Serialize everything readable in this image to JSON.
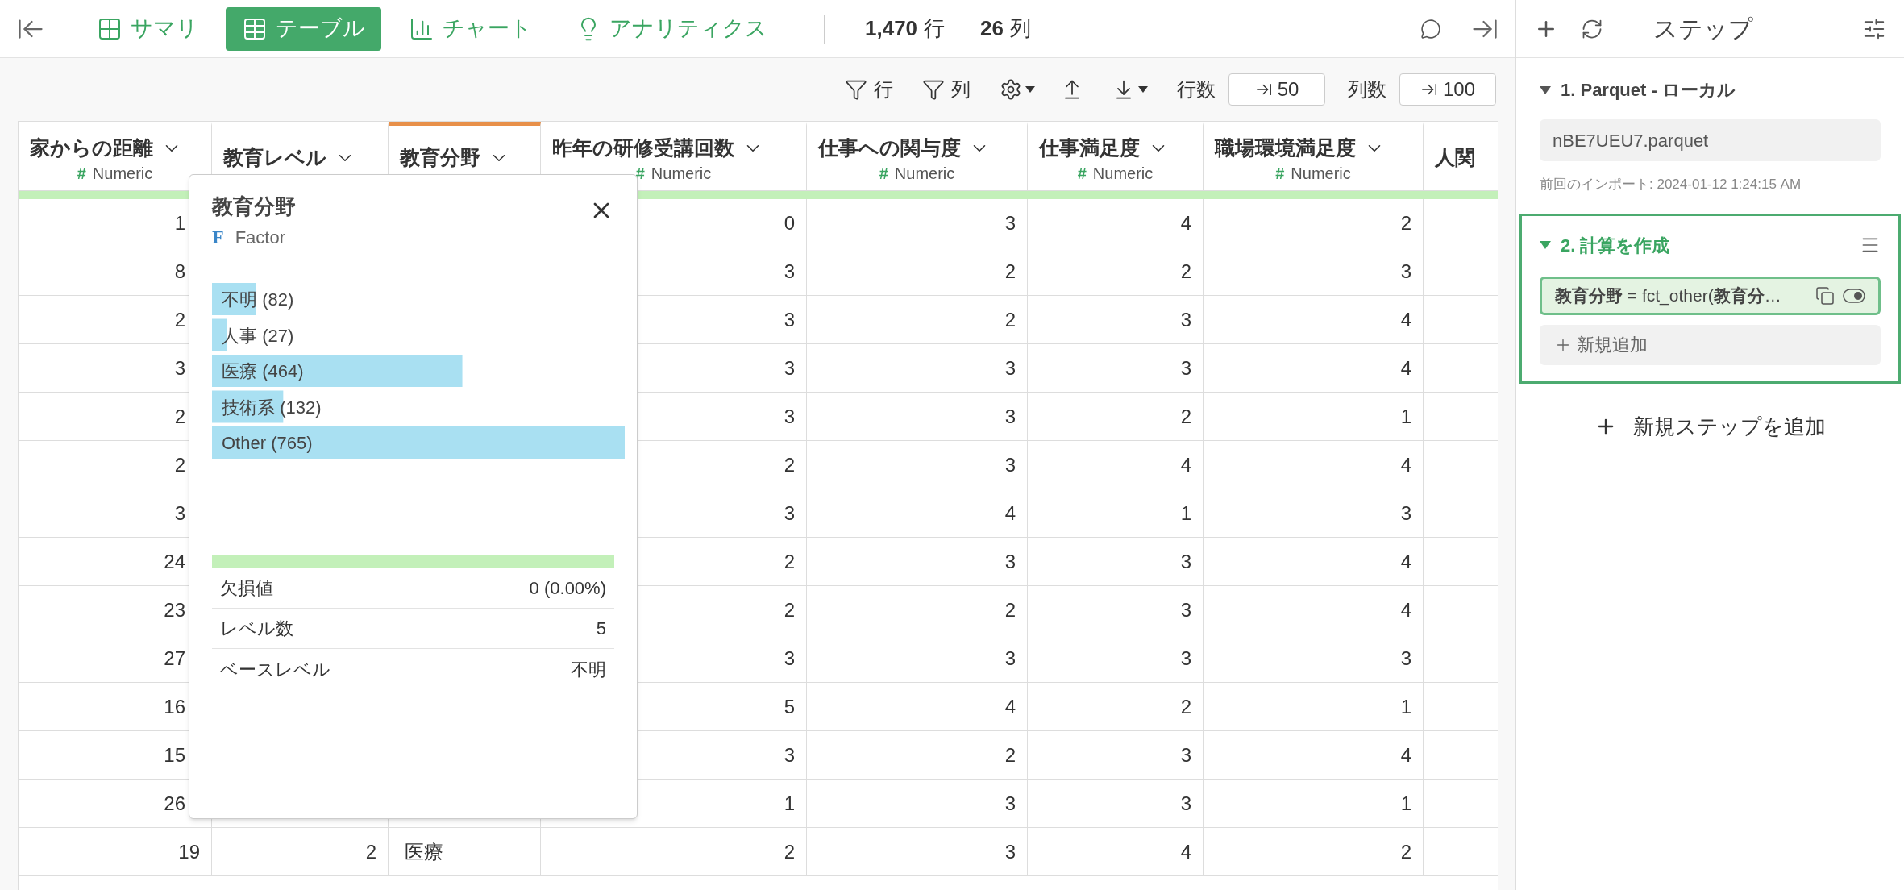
{
  "tabs": [
    {
      "label": "サマリ",
      "selected": false
    },
    {
      "label": "テーブル",
      "selected": true
    },
    {
      "label": "チャート",
      "selected": false
    },
    {
      "label": "アナリティクス",
      "selected": false
    }
  ],
  "counts": [
    {
      "number": "1,470",
      "unit": "行"
    },
    {
      "number": "26",
      "unit": "列"
    }
  ],
  "toolbar": {
    "row_filter": "行",
    "col_filter": "列",
    "rows_label": "行数",
    "rows_value": "50",
    "cols_label": "列数",
    "cols_value": "100"
  },
  "table": {
    "columns": [
      {
        "title": "家からの距離",
        "type_mark": "#",
        "type": "Numeric",
        "kind": "numeric",
        "selected": false
      },
      {
        "title": "教育レベル",
        "selected": false
      },
      {
        "title": "教育分野",
        "selected": true
      },
      {
        "title": "昨年の研修受講回数",
        "type_mark": "#",
        "type": "Numeric",
        "kind": "numeric",
        "selected": false
      },
      {
        "title": "仕事への関与度",
        "type_mark": "#",
        "type": "Numeric",
        "kind": "numeric",
        "selected": false
      },
      {
        "title": "仕事満足度",
        "type_mark": "#",
        "type": "Numeric",
        "kind": "numeric",
        "selected": false
      },
      {
        "title": "職場環境満足度",
        "type_mark": "#",
        "type": "Numeric",
        "kind": "numeric",
        "selected": false
      },
      {
        "title": "人関"
      }
    ],
    "rows": [
      [
        "1",
        null,
        null,
        "0",
        "3",
        "4",
        "2"
      ],
      [
        "8",
        null,
        null,
        "3",
        "2",
        "2",
        "3"
      ],
      [
        "2",
        null,
        null,
        "3",
        "2",
        "3",
        "4"
      ],
      [
        "3",
        null,
        null,
        "3",
        "3",
        "3",
        "4"
      ],
      [
        "2",
        null,
        null,
        "3",
        "3",
        "2",
        "1"
      ],
      [
        "2",
        null,
        null,
        "2",
        "3",
        "4",
        "4"
      ],
      [
        "3",
        null,
        null,
        "3",
        "4",
        "1",
        "3"
      ],
      [
        "24",
        null,
        null,
        "2",
        "3",
        "3",
        "4"
      ],
      [
        "23",
        null,
        null,
        "2",
        "2",
        "3",
        "4"
      ],
      [
        "27",
        null,
        null,
        "3",
        "3",
        "3",
        "3"
      ],
      [
        "16",
        null,
        null,
        "5",
        "4",
        "2",
        "1"
      ],
      [
        "15",
        null,
        null,
        "3",
        "2",
        "3",
        "4"
      ],
      [
        "26",
        null,
        null,
        "1",
        "3",
        "3",
        "1"
      ],
      [
        "19",
        "2",
        "医療",
        "2",
        "3",
        "4",
        "2"
      ]
    ]
  },
  "popup": {
    "title": "教育分野",
    "type_mark": "F",
    "type": "Factor",
    "chart_data": {
      "type": "bar",
      "orientation": "horizontal",
      "categories": [
        "不明",
        "人事",
        "医療",
        "技術系",
        "Other"
      ],
      "values": [
        82,
        27,
        464,
        132,
        765
      ],
      "value_labels": [
        "(82)",
        "(27)",
        "(464)",
        "(132)",
        "(765)"
      ]
    },
    "stats": [
      {
        "label": "欠損値",
        "value": "0 (0.00%)"
      },
      {
        "label": "レベル数",
        "value": "5"
      },
      {
        "label": "ベースレベル",
        "value": "不明"
      }
    ]
  },
  "steps_panel": {
    "title": "ステップ",
    "add_step": "新規ステップを追加",
    "steps": [
      {
        "kind": "source",
        "title": "1. Parquet - ローカル",
        "expanded": true,
        "selected": false,
        "file": "nBE7UEU7.parquet",
        "note": "前回のインポート: 2024-01-12 1:24:15 AM"
      },
      {
        "kind": "calc",
        "title": "2. 計算を作成",
        "expanded": true,
        "selected": true,
        "formula": "**教育分野** = fct_other(**教育分**…",
        "formula_on": true,
        "add_label": "新規追加"
      }
    ]
  }
}
